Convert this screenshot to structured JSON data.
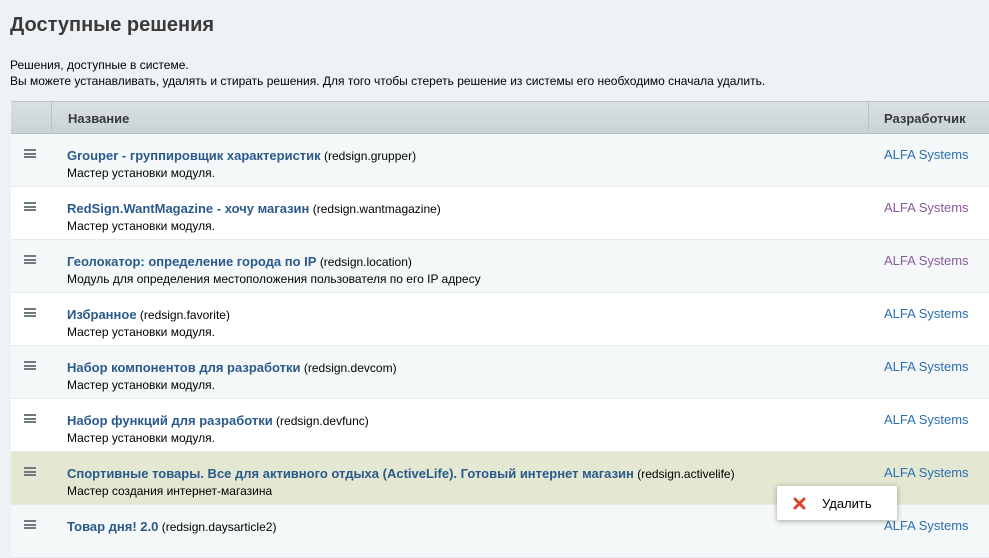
{
  "page": {
    "title": "Доступные решения",
    "intro_line1": "Решения, доступные в системе.",
    "intro_line2": "Вы можете устанавливать, удалять и стирать решения. Для того чтобы стереть решение из системы его необходимо сначала удалить."
  },
  "table": {
    "columns": {
      "name": "Название",
      "developer": "Разработчик"
    },
    "rows": [
      {
        "name": "Grouper - группировщик характеристик",
        "code": "(redsign.grupper)",
        "desc": "Мастер установки модуля.",
        "developer": "ALFA Systems"
      },
      {
        "name": "RedSign.WantMagazine - хочу магазин",
        "code": "(redsign.wantmagazine)",
        "desc": "Мастер установки модуля.",
        "developer": "ALFA Systems"
      },
      {
        "name": "Геолокатор: определение города по IP",
        "code": "(redsign.location)",
        "desc": "Модуль для определения местоположения пользователя по его IP адресу",
        "developer": "ALFA Systems"
      },
      {
        "name": "Избранное",
        "code": "(redsign.favorite)",
        "desc": "Мастер установки модуля.",
        "developer": "ALFA Systems"
      },
      {
        "name": "Набор компонентов для разработки",
        "code": "(redsign.devcom)",
        "desc": "Мастер установки модуля.",
        "developer": "ALFA Systems"
      },
      {
        "name": "Набор функций для разработки",
        "code": "(redsign.devfunc)",
        "desc": "Мастер установки модуля.",
        "developer": "ALFA Systems"
      },
      {
        "name": "Спортивные товары. Все для активного отдыха (ActiveLife). Готовый интернет магазин",
        "code": "(redsign.activelife)",
        "desc": "Мастер создания интернет-магазина",
        "developer": "ALFA Systems"
      },
      {
        "name": "Товар дня! 2.0",
        "code": "(redsign.daysarticle2)",
        "desc": "",
        "developer": "ALFA Systems"
      }
    ]
  },
  "context_menu": {
    "delete_label": "Удалить"
  },
  "colors": {
    "link": "#2a5a8c",
    "visited": "#8a5a9c",
    "highlight_row": "#e4e8d2",
    "delete_icon": "#d9452b"
  }
}
